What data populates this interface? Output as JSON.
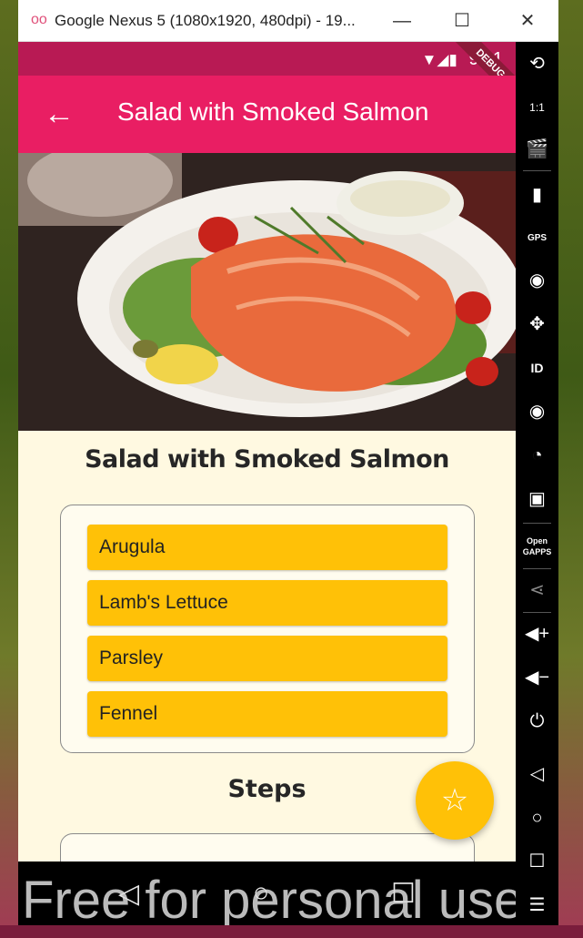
{
  "window": {
    "logo": "oo",
    "title": "Google Nexus 5 (1080x1920, 480dpi) - 19...",
    "minimize": "—",
    "maximize": "☐",
    "close": "✕"
  },
  "status_bar": {
    "icons": "▼◢▮",
    "time": "9:11",
    "debug_label": "DEBUG"
  },
  "app_bar": {
    "back_icon": "←",
    "title": "Salad with Smoked Salmon"
  },
  "recipe": {
    "title": "Salad with Smoked Salmon",
    "ingredients": [
      {
        "label": "Arugula"
      },
      {
        "label": "Lamb's Lettuce"
      },
      {
        "label": "Parsley"
      },
      {
        "label": "Fennel"
      }
    ],
    "steps_title": "Steps"
  },
  "fab": {
    "icon": "☆"
  },
  "nav": {
    "back": "◁",
    "home": "○",
    "recent": "☐"
  },
  "watermark": "Free for personal use",
  "toolbar": {
    "rotate": "⟲",
    "fit": "1:1",
    "screenshot": "🎬",
    "battery": "▮",
    "gps": "GPS",
    "camera": "◉",
    "dpad": "✥",
    "id": "ID",
    "media": "◉",
    "cast": "◔",
    "sms": "▣",
    "opengapps": "Open GAPPS",
    "share": "⋖",
    "vol_up": "◀+",
    "vol_down": "◀−",
    "power": "⏻",
    "back": "◁",
    "home": "○",
    "recent": "☐",
    "menu": "☰"
  },
  "colors": {
    "primary": "#e91e63",
    "primary_dark": "#b81a54",
    "accent": "#ffc107",
    "background": "#fff9e1"
  }
}
